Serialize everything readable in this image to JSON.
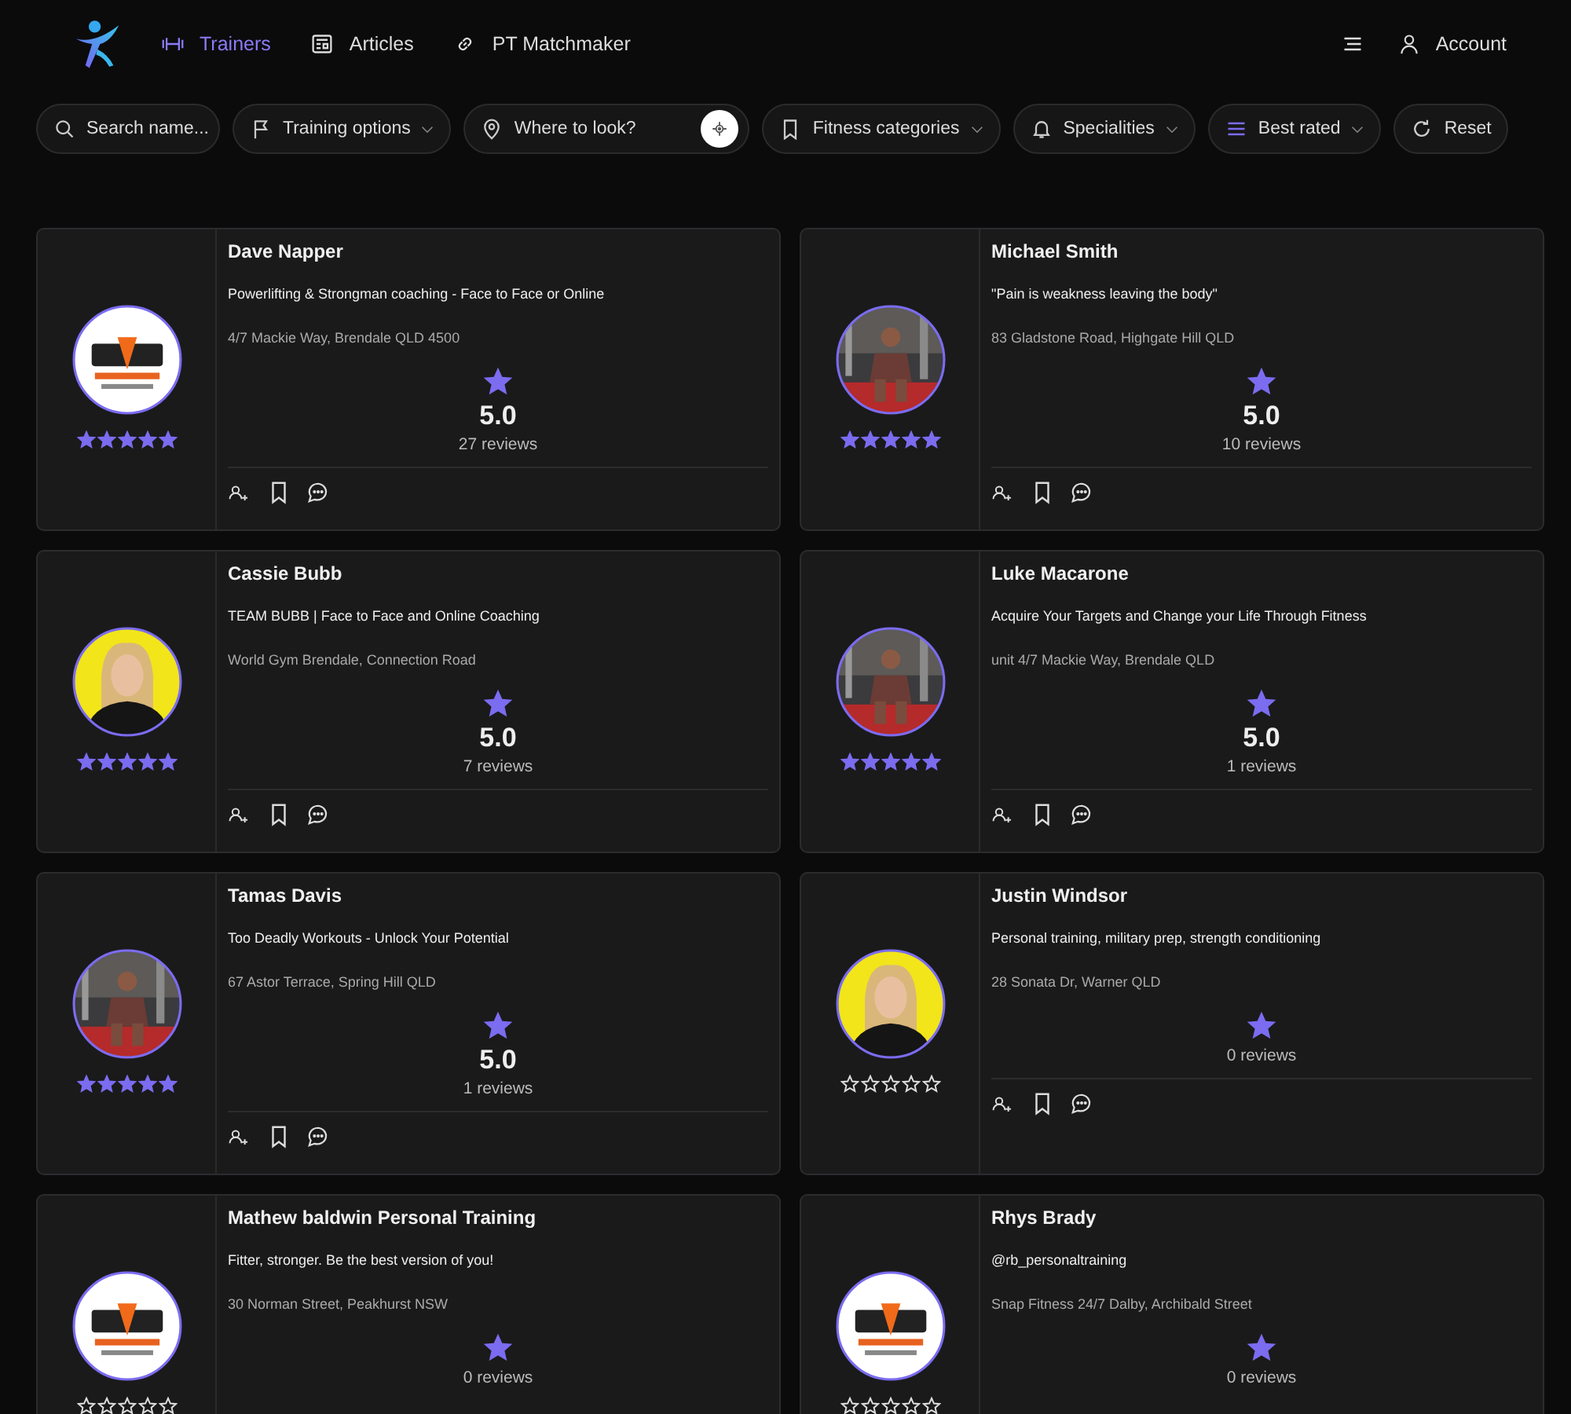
{
  "nav": {
    "links": [
      {
        "label": "Trainers",
        "selected": true
      },
      {
        "label": "Articles",
        "selected": false
      },
      {
        "label": "PT Matchmaker",
        "selected": false
      }
    ],
    "account": "Account"
  },
  "filters": [
    {
      "kind": "field",
      "placeholder": "Search name..."
    },
    {
      "kind": "dropdown",
      "label": "Training options"
    },
    {
      "kind": "location",
      "placeholder": "Where to look?"
    },
    {
      "kind": "dropdown",
      "label": "Fitness categories"
    },
    {
      "kind": "dropdown",
      "label": "Specialities"
    },
    {
      "kind": "dropdown",
      "label": "Best rated"
    },
    {
      "kind": "button",
      "label": "Reset"
    }
  ],
  "trainers": [
    {
      "name": "Dave Napper",
      "tagline": "Powerlifting & Strongman coaching - Face to Face or Online",
      "address": "4/7 Mackie Way, Brendale QLD 4500",
      "stars": 5,
      "rating": "5.0",
      "reviews": "27 reviews"
    },
    {
      "name": "Michael Smith",
      "tagline": "\"Pain is weakness leaving the body\"",
      "address": "83 Gladstone Road, Highgate Hill QLD",
      "stars": 5,
      "rating": "5.0",
      "reviews": "10 reviews"
    },
    {
      "name": "Cassie Bubb",
      "tagline": "TEAM BUBB | Face to Face and Online Coaching",
      "address": "World Gym Brendale, Connection Road",
      "stars": 5,
      "rating": "5.0",
      "reviews": "7 reviews"
    },
    {
      "name": "Luke Macarone",
      "tagline": "Acquire Your Targets and Change your Life Through Fitness",
      "address": "unit 4/7 Mackie Way, Brendale QLD",
      "stars": 5,
      "rating": "5.0",
      "reviews": "1 reviews"
    },
    {
      "name": "Tamas Davis",
      "tagline": "Too Deadly Workouts - Unlock Your Potential",
      "address": "67 Astor Terrace, Spring Hill QLD",
      "stars": 5,
      "rating": "5.0",
      "reviews": "1 reviews"
    },
    {
      "name": "Justin Windsor",
      "tagline": "Personal training, military prep, strength conditioning",
      "address": "28 Sonata Dr, Warner QLD",
      "stars": 0,
      "reviews": "0 reviews"
    },
    {
      "name": "Mathew baldwin Personal Training",
      "tagline": "Fitter, stronger. Be the best version of you!",
      "address": "30 Norman Street, Peakhurst NSW",
      "stars": 0,
      "reviews": "0 reviews"
    },
    {
      "name": "Rhys Brady",
      "tagline": "@rb_personaltraining",
      "address": "Snap Fitness 24/7 Dalby, Archibald Street",
      "stars": 0,
      "reviews": "0 reviews"
    }
  ]
}
